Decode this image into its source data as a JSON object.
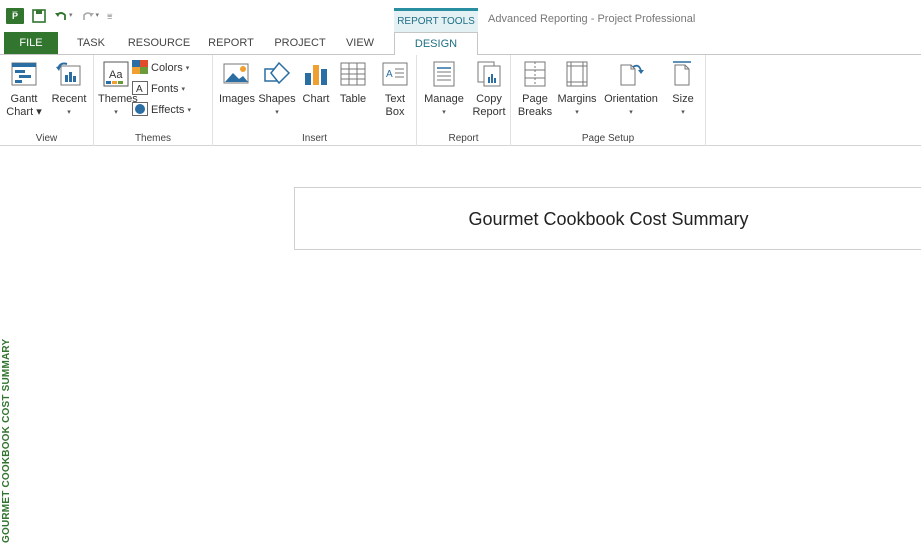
{
  "title_bar": {
    "app_icon_text": "P̅",
    "context_tab": "REPORT TOOLS",
    "window_title": "Advanced Reporting - Project Professional"
  },
  "tabs": [
    "FILE",
    "TASK",
    "RESOURCE",
    "REPORT",
    "PROJECT",
    "VIEW",
    "DESIGN"
  ],
  "ribbon": {
    "view": {
      "label": "View",
      "gantt": {
        "line1": "Gantt",
        "line2": "Chart ▾"
      },
      "recent": {
        "line1": "Recent",
        "line2": "▾"
      }
    },
    "themes": {
      "label": "Themes",
      "themes_btn": {
        "line1": "Themes",
        "line2": "▾"
      },
      "colors": "Colors",
      "fonts": "Fonts",
      "effects": "Effects"
    },
    "insert": {
      "label": "Insert",
      "images": "Images",
      "shapes": "Shapes",
      "chart": "Chart",
      "table": "Table",
      "textbox": {
        "line1": "Text",
        "line2": "Box"
      }
    },
    "report": {
      "label": "Report",
      "manage": "Manage",
      "copy": {
        "line1": "Copy",
        "line2": "Report"
      }
    },
    "page_setup": {
      "label": "Page Setup",
      "page_breaks": {
        "line1": "Page",
        "line2": "Breaks"
      },
      "margins": "Margins",
      "orientation": "Orientation",
      "size": "Size"
    }
  },
  "report": {
    "title": "Gourmet Cookbook Cost Summary",
    "side_label": "GOURMET COOKBOOK COST SUMMARY"
  },
  "colors": {
    "accent_green": "#31752f",
    "context_teal": "#2a8ea3"
  }
}
